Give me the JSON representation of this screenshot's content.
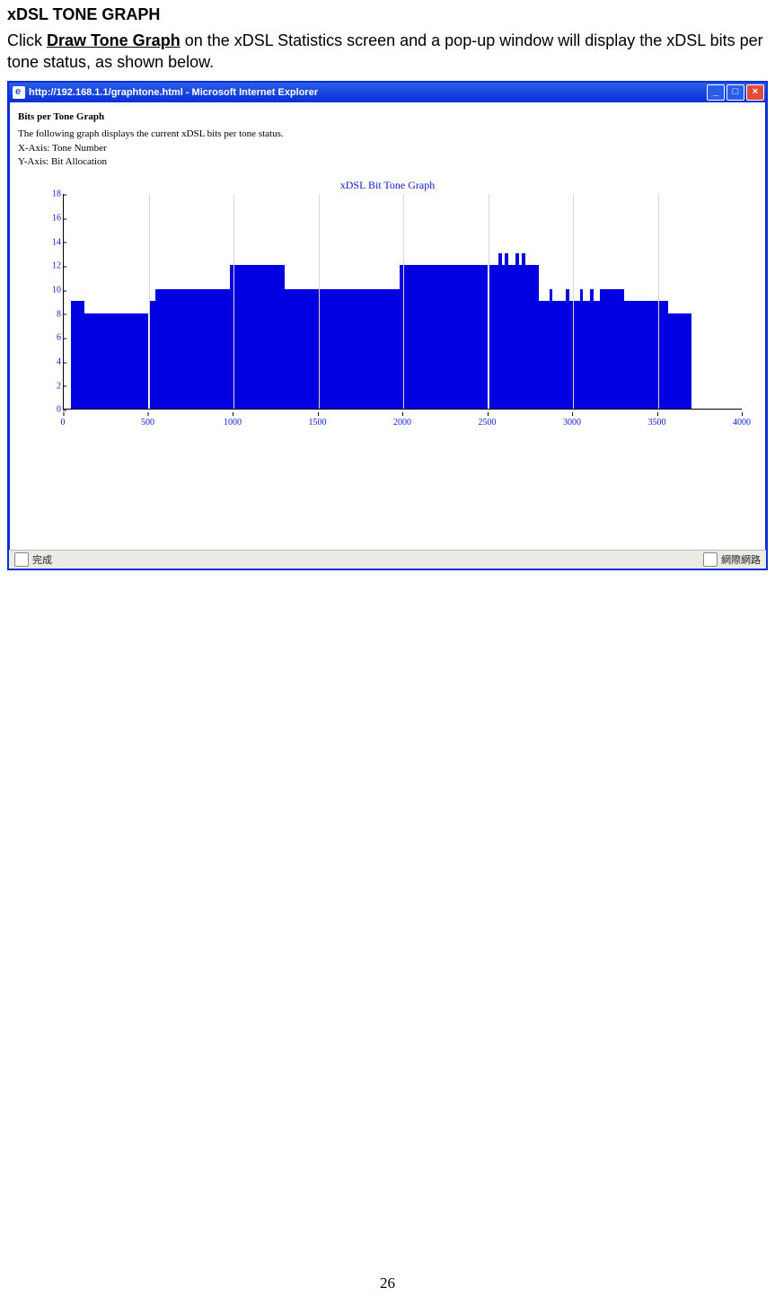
{
  "page": {
    "heading": "xDSL TONE GRAPH",
    "intro_pre": "Click ",
    "intro_bold": "Draw Tone Graph",
    "intro_post": " on the xDSL Statistics screen and a pop-up window will display the xDSL bits per tone status, as shown below.",
    "number": "26"
  },
  "window": {
    "title": "http://192.168.1.1/graphtone.html - Microsoft Internet Explorer",
    "content": {
      "title": "Bits per Tone Graph",
      "line1": "The following graph displays the current xDSL bits per tone status.",
      "line2": "X-Axis: Tone Number",
      "line3": "Y-Axis: Bit Allocation"
    },
    "status_left": "完成",
    "status_right": "網際網路"
  },
  "chart_data": {
    "type": "bar",
    "title": "xDSL Bit Tone Graph",
    "xlabel": "",
    "ylabel": "",
    "x_range": [
      0,
      4000
    ],
    "y_range": [
      0,
      18
    ],
    "x_ticks": [
      0,
      500,
      1000,
      1500,
      2000,
      2500,
      3000,
      3500,
      4000
    ],
    "y_ticks": [
      0,
      2,
      4,
      6,
      8,
      10,
      12,
      14,
      16,
      18
    ],
    "segments": [
      {
        "x0": 40,
        "x1": 120,
        "y": 9
      },
      {
        "x0": 120,
        "x1": 500,
        "y": 8
      },
      {
        "x0": 500,
        "x1": 540,
        "y": 9
      },
      {
        "x0": 540,
        "x1": 980,
        "y": 10
      },
      {
        "x0": 980,
        "x1": 1300,
        "y": 12
      },
      {
        "x0": 1300,
        "x1": 1980,
        "y": 10
      },
      {
        "x0": 1980,
        "x1": 2500,
        "y": 12
      },
      {
        "x0": 2500,
        "x1": 2560,
        "y": 12
      },
      {
        "x0": 2560,
        "x1": 2580,
        "y": 13
      },
      {
        "x0": 2580,
        "x1": 2600,
        "y": 12
      },
      {
        "x0": 2600,
        "x1": 2620,
        "y": 13
      },
      {
        "x0": 2620,
        "x1": 2660,
        "y": 12
      },
      {
        "x0": 2660,
        "x1": 2680,
        "y": 13
      },
      {
        "x0": 2680,
        "x1": 2700,
        "y": 12
      },
      {
        "x0": 2700,
        "x1": 2720,
        "y": 13
      },
      {
        "x0": 2720,
        "x1": 2800,
        "y": 12
      },
      {
        "x0": 2800,
        "x1": 2860,
        "y": 9
      },
      {
        "x0": 2860,
        "x1": 2880,
        "y": 10
      },
      {
        "x0": 2880,
        "x1": 2960,
        "y": 9
      },
      {
        "x0": 2960,
        "x1": 2980,
        "y": 10
      },
      {
        "x0": 2980,
        "x1": 3040,
        "y": 9
      },
      {
        "x0": 3040,
        "x1": 3060,
        "y": 10
      },
      {
        "x0": 3060,
        "x1": 3100,
        "y": 9
      },
      {
        "x0": 3100,
        "x1": 3120,
        "y": 10
      },
      {
        "x0": 3120,
        "x1": 3160,
        "y": 9
      },
      {
        "x0": 3160,
        "x1": 3180,
        "y": 10
      },
      {
        "x0": 3180,
        "x1": 3300,
        "y": 10
      },
      {
        "x0": 3300,
        "x1": 3560,
        "y": 9
      },
      {
        "x0": 3560,
        "x1": 3700,
        "y": 8
      }
    ]
  }
}
